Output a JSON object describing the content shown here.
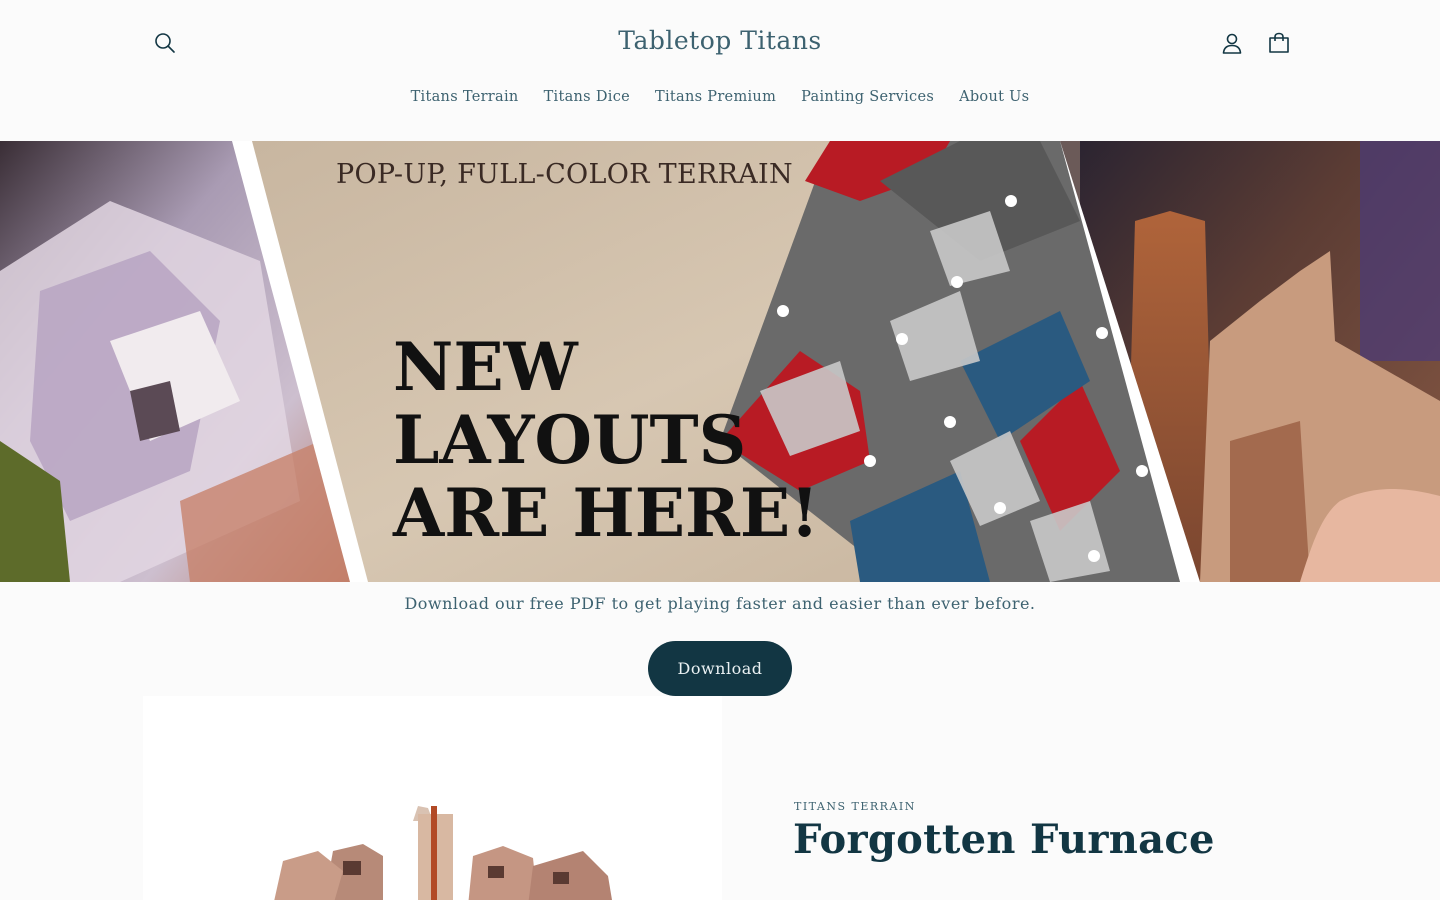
{
  "header": {
    "brand": "Tabletop Titans",
    "icons": {
      "search": "search-icon",
      "account": "user-icon",
      "cart": "cart-icon"
    }
  },
  "nav": {
    "items": [
      {
        "label": "Titans Terrain"
      },
      {
        "label": "Titans Dice"
      },
      {
        "label": "Titans Premium"
      },
      {
        "label": "Painting Services"
      },
      {
        "label": "About Us"
      }
    ]
  },
  "hero": {
    "tagline": "POP-UP, FULL-COLOR TERRAIN",
    "headline": "NEW\nLAYOUTS\nARE HERE!"
  },
  "promo": {
    "text": "Download our free PDF to get playing faster and easier than ever before.",
    "button_label": "Download"
  },
  "product": {
    "vendor": "TITANS TERRAIN",
    "title": "Forgotten Furnace"
  },
  "colors": {
    "primary": "#123643",
    "text_muted": "#3d6270",
    "background": "#fbfbfb",
    "map_red": "#b81b24",
    "map_gray": "#6a6a6a",
    "map_blue": "#2a5a80"
  }
}
